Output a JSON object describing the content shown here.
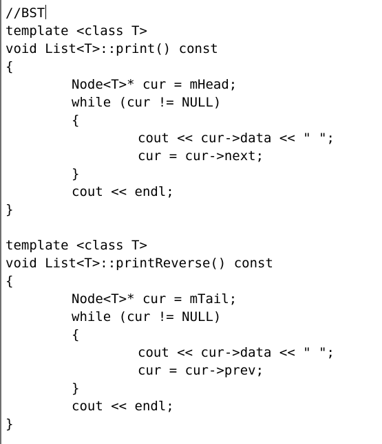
{
  "editor": {
    "lines": [
      {
        "text": "//BST",
        "indent": 0,
        "caret": true
      },
      {
        "text": "template <class T>",
        "indent": 0
      },
      {
        "text": "void List<T>::print() const",
        "indent": 0
      },
      {
        "text": "{",
        "indent": 0
      },
      {
        "text": "Node<T>* cur = mHead;",
        "indent": 1
      },
      {
        "text": "while (cur != NULL)",
        "indent": 1
      },
      {
        "text": "{",
        "indent": 1
      },
      {
        "text": "cout << cur->data << \" \";",
        "indent": 2
      },
      {
        "text": "cur = cur->next;",
        "indent": 2
      },
      {
        "text": "}",
        "indent": 1
      },
      {
        "text": "cout << endl;",
        "indent": 1
      },
      {
        "text": "}",
        "indent": 0
      },
      {
        "text": "",
        "indent": 0
      },
      {
        "text": "template <class T>",
        "indent": 0
      },
      {
        "text": "void List<T>::printReverse() const",
        "indent": 0
      },
      {
        "text": "{",
        "indent": 0
      },
      {
        "text": "Node<T>* cur = mTail;",
        "indent": 1
      },
      {
        "text": "while (cur != NULL)",
        "indent": 1
      },
      {
        "text": "{",
        "indent": 1
      },
      {
        "text": "cout << cur->data << \" \";",
        "indent": 2
      },
      {
        "text": "cur = cur->prev;",
        "indent": 2
      },
      {
        "text": "}",
        "indent": 1
      },
      {
        "text": "cout << endl;",
        "indent": 1
      },
      {
        "text": "}",
        "indent": 0
      }
    ]
  }
}
